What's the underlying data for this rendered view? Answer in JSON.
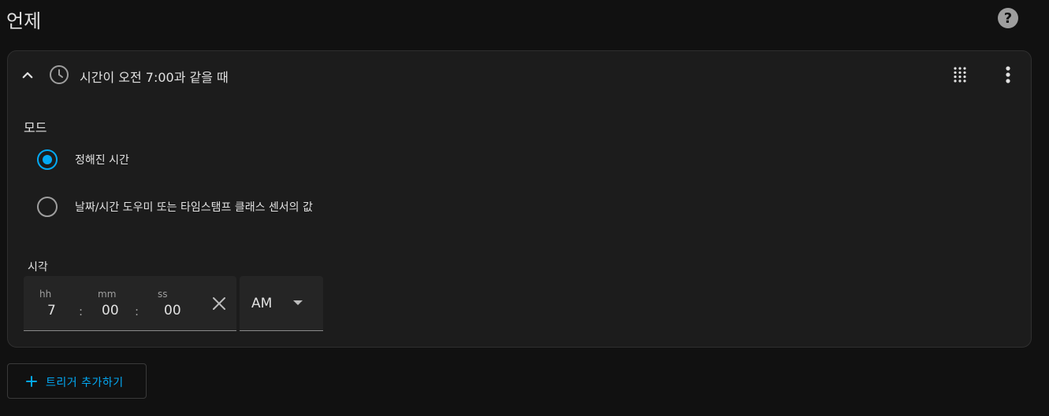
{
  "page": {
    "title": "언제",
    "help_icon": "help-circle-icon",
    "help_label": "?"
  },
  "trigger_card": {
    "title": "시간이 오전 7:00과 같을 때",
    "collapse_icon": "chevron-up-icon",
    "type_icon": "clock-outline-icon",
    "drag_icon": "drag-handle-icon",
    "menu_icon": "more-vertical-icon",
    "mode": {
      "label": "모드",
      "options": [
        {
          "label": "정해진 시간",
          "selected": true
        },
        {
          "label": "날짜/시간 도우미 또는 타임스탬프 클래스 센서의 값",
          "selected": false
        }
      ]
    },
    "time": {
      "label": "시각",
      "hh_unit": "hh",
      "mm_unit": "mm",
      "ss_unit": "ss",
      "hh": "7",
      "mm": "00",
      "ss": "00",
      "separator": ":",
      "clear_icon": "close-icon",
      "ampm": "AM",
      "ampm_icon": "caret-down-icon"
    }
  },
  "actions": {
    "add_trigger_label": "트리거 추가하기",
    "add_icon": "plus-icon"
  },
  "colors": {
    "background": "#111111",
    "card": "#1c1c1c",
    "accent": "#03a9f4",
    "text": "#e1e1e1"
  }
}
